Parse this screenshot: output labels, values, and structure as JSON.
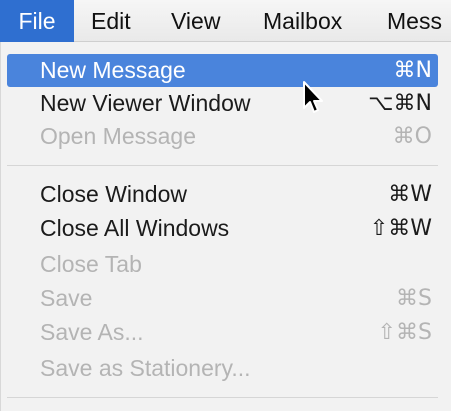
{
  "menubar": {
    "items": [
      {
        "label": "File"
      },
      {
        "label": "Edit"
      },
      {
        "label": "View"
      },
      {
        "label": "Mailbox"
      },
      {
        "label": "Mess"
      }
    ]
  },
  "file_menu": {
    "items": [
      {
        "label": "New Message",
        "shortcut": "⌘N"
      },
      {
        "label": "New Viewer Window",
        "shortcut": "⌥⌘N"
      },
      {
        "label": "Open Message",
        "shortcut": "⌘O"
      },
      {
        "label": "Close Window",
        "shortcut": "⌘W"
      },
      {
        "label": "Close All Windows",
        "shortcut": "⇧⌘W"
      },
      {
        "label": "Close Tab",
        "shortcut": ""
      },
      {
        "label": "Save",
        "shortcut": "⌘S"
      },
      {
        "label": "Save As...",
        "shortcut": "⇧⌘S"
      },
      {
        "label": "Save as Stationery...",
        "shortcut": ""
      }
    ]
  },
  "colors": {
    "selection": "#4a84dc",
    "menubar_active": "#2f6fd0",
    "disabled_text": "#b4b4b4"
  },
  "icons": {
    "cursor": "mouse-pointer-icon"
  }
}
